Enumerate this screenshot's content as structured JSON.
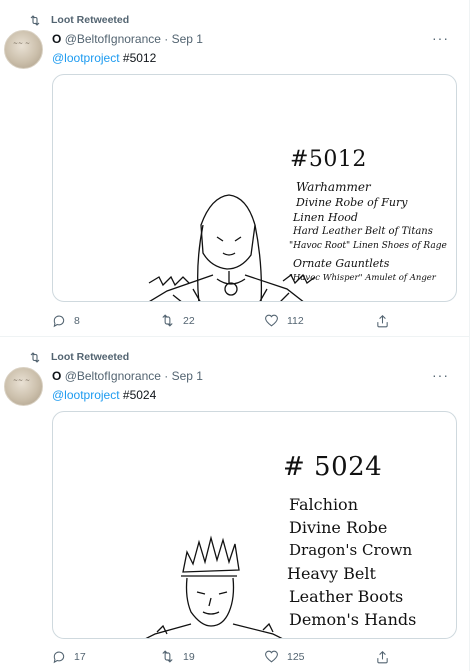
{
  "tweets": [
    {
      "retweet_label": "Loot Retweeted",
      "display_name": "O",
      "handle": "@BeltofIgnorance",
      "separator": "·",
      "date": "Sep 1",
      "mention": "@lootproject",
      "hashtag_text": "#5012",
      "art": {
        "number": "#5012",
        "items": [
          "Warhammer",
          "Divine Robe of Fury",
          "Linen Hood",
          "Hard Leather Belt of Titans",
          "\"Havoc Root\" Linen Shoes of Rage",
          "Ornate Gauntlets",
          "\"Havoc Whisper\" Amulet of Anger"
        ]
      },
      "replies": "8",
      "retweets": "22",
      "likes": "112"
    },
    {
      "retweet_label": "Loot Retweeted",
      "display_name": "O",
      "handle": "@BeltofIgnorance",
      "separator": "·",
      "date": "Sep 1",
      "mention": "@lootproject",
      "hashtag_text": "#5024",
      "art": {
        "number": "# 5024",
        "items": [
          "Falchion",
          "Divine Robe",
          "Dragon's Crown",
          "Heavy Belt",
          "Leather Boots",
          "Demon's Hands"
        ]
      },
      "replies": "17",
      "retweets": "19",
      "likes": "125"
    }
  ],
  "colors": {
    "accent": "#1d9bf0",
    "muted": "#536471",
    "border": "#cfd9de"
  },
  "icons": [
    "retweet-icon",
    "more-icon",
    "reply-icon",
    "like-icon",
    "share-icon"
  ]
}
